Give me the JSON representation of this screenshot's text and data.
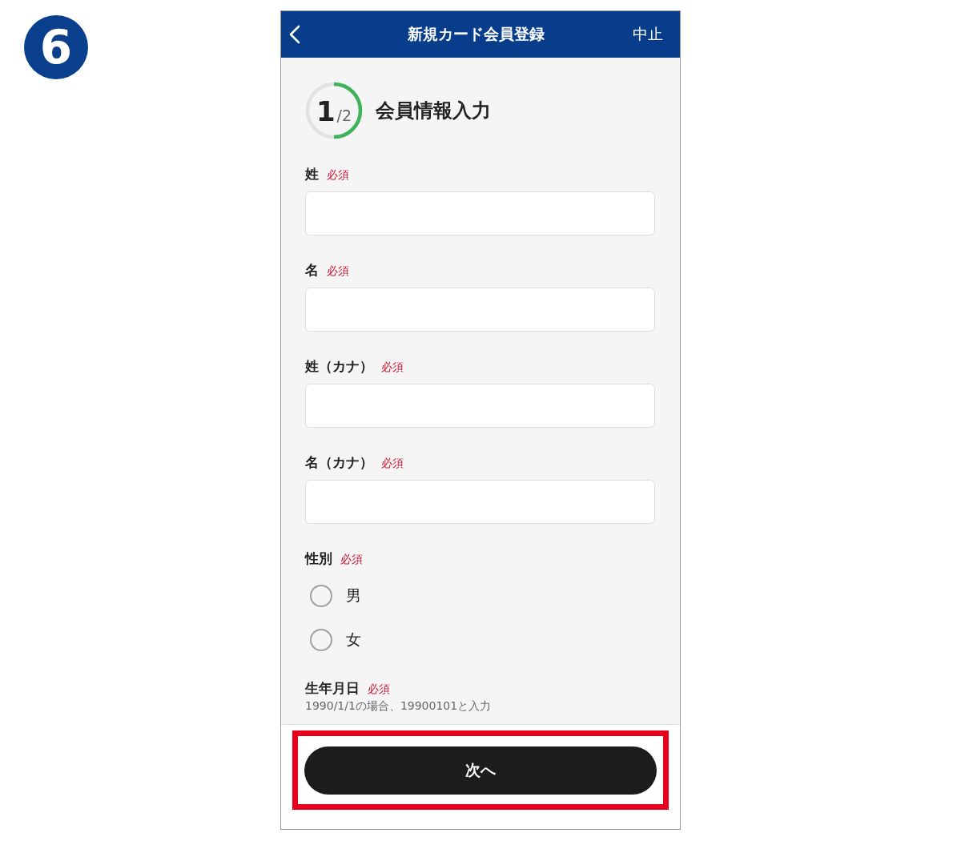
{
  "step_badge": "6",
  "header": {
    "title": "新規カード会員登録",
    "cancel": "中止"
  },
  "progress": {
    "current": "1",
    "total": "/2",
    "level": 0.5,
    "title": "会員情報入力"
  },
  "fields": [
    {
      "kind": "text",
      "label": "姓",
      "required": true,
      "required_label": "必須"
    },
    {
      "kind": "text",
      "label": "名",
      "required": true,
      "required_label": "必須"
    },
    {
      "kind": "text",
      "label": "姓（カナ）",
      "required": true,
      "required_label": "必須"
    },
    {
      "kind": "text",
      "label": "名（カナ）",
      "required": true,
      "required_label": "必須"
    },
    {
      "kind": "radio",
      "label": "性別",
      "required": true,
      "required_label": "必須",
      "options": [
        {
          "label": "男",
          "selected": false
        },
        {
          "label": "女",
          "selected": false
        }
      ]
    },
    {
      "kind": "date",
      "label": "生年月日",
      "required": true,
      "required_label": "必須",
      "hint": "1990/1/1の場合、19900101と入力"
    }
  ],
  "footer": {
    "next_button": "次へ",
    "highlighted": true
  }
}
